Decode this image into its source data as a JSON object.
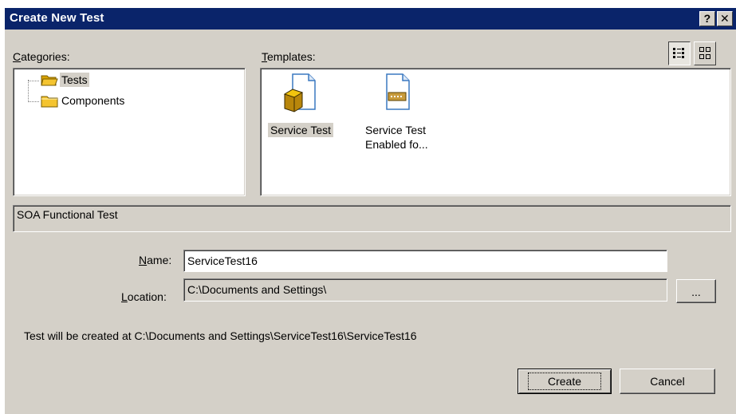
{
  "window": {
    "title": "Create New Test",
    "help_glyph": "?",
    "close_glyph": "✕"
  },
  "categories": {
    "label_first": "C",
    "label_rest": "ategories:",
    "items": [
      {
        "label": "Tests",
        "selected": true,
        "icon": "folder-open-icon"
      },
      {
        "label": "Components",
        "selected": false,
        "icon": "folder-icon"
      }
    ]
  },
  "templates": {
    "label_first": "T",
    "label_rest": "emplates:",
    "items": [
      {
        "label": "Service Test",
        "selected": true,
        "icon": "service-test-icon"
      },
      {
        "label_line1": "Service Test",
        "label_line2": "Enabled fo...",
        "selected": false,
        "icon": "service-test-enabled-icon"
      }
    ],
    "view_modes": [
      "list-view-icon",
      "large-icon-view-icon"
    ]
  },
  "description": "SOA Functional Test",
  "name_field": {
    "label_first": "N",
    "label_rest": "ame:",
    "value": "ServiceTest16"
  },
  "location_field": {
    "label_first": "L",
    "label_rest": "ocation:",
    "value": "C:\\Documents and Settings\\",
    "browse_label": "..."
  },
  "info_text": "Test will be created at C:\\Documents and Settings\\ServiceTest16\\ServiceTest16",
  "buttons": {
    "create": "Create",
    "cancel": "Cancel"
  },
  "colors": {
    "titlebar": "#0a246a",
    "dialog_bg": "#d4d0c8",
    "folder": "#f4c430"
  }
}
